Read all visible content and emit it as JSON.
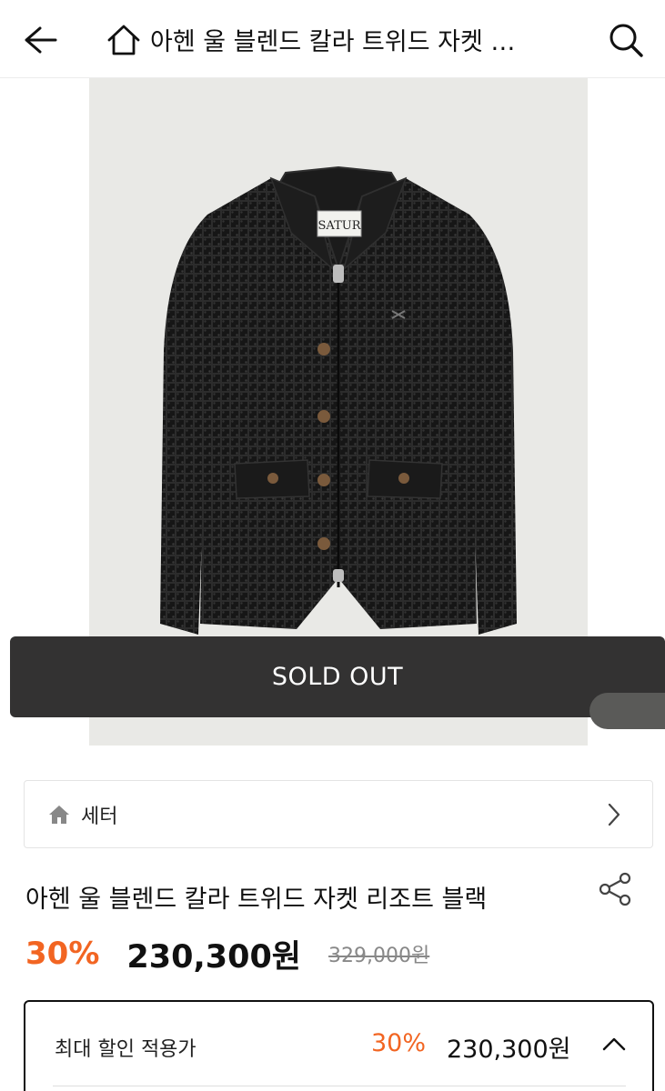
{
  "header": {
    "title": "아헨 울 블렌드 칼라 트위드 자켓 리조트 블랙",
    "back_icon": "arrow-left-icon",
    "home_icon": "home-outline-icon",
    "search_icon": "search-icon"
  },
  "product_image": {
    "label_text": "SATUR"
  },
  "overlay": {
    "sold_out": "SOLD OUT"
  },
  "category": {
    "icon": "home-filled-icon",
    "label": "세터",
    "chevron": "chevron-right-icon"
  },
  "product": {
    "title": "아헨 울 블렌드 칼라 트위드 자켓 리조트 블랙",
    "share_icon": "share-icon",
    "discount": "30%",
    "price": "230,300원",
    "original_price": "329,000원"
  },
  "max_discount": {
    "label": "최대 할인 적용가",
    "discount": "30%",
    "price": "230,300원",
    "chevron": "chevron-up-icon"
  },
  "colors": {
    "accent": "#f26522",
    "sold_out_bg": "#333232",
    "image_bg": "#e9e9e6"
  }
}
